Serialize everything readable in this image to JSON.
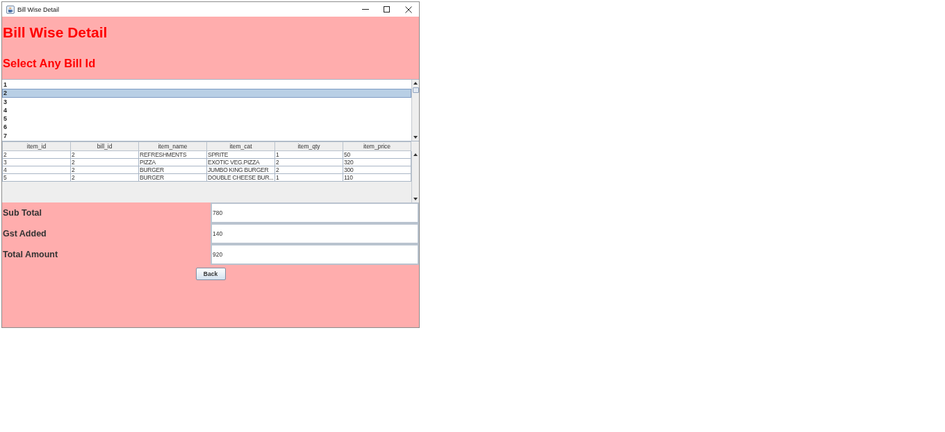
{
  "window": {
    "title": "Bill Wise Detail"
  },
  "header": {
    "title": "Bill Wise Detail",
    "subtitle": "Select Any Bill Id"
  },
  "bill_list": [
    {
      "label": "1",
      "selected": false
    },
    {
      "label": "2",
      "selected": true
    },
    {
      "label": "3",
      "selected": false
    },
    {
      "label": "4",
      "selected": false
    },
    {
      "label": "5",
      "selected": false
    },
    {
      "label": "6",
      "selected": false
    },
    {
      "label": "7",
      "selected": false
    }
  ],
  "table": {
    "columns": [
      "item_id",
      "bill_id",
      "item_name",
      "item_cat",
      "item_qty",
      "item_price"
    ],
    "rows": [
      [
        "2",
        "2",
        "REFRESHMENTS",
        "SPRITE",
        "1",
        "50"
      ],
      [
        "3",
        "2",
        "PIZZA",
        "EXOTIC VEG.PIZZA",
        "2",
        "320"
      ],
      [
        "4",
        "2",
        "BURGER",
        "JUMBO KING BURGER",
        "2",
        "300"
      ],
      [
        "5",
        "2",
        "BURGER",
        "DOUBLE CHEESE BUR...",
        "1",
        "110"
      ]
    ]
  },
  "totals": [
    {
      "label": "Sub Total",
      "value": "780"
    },
    {
      "label": "Gst Added",
      "value": "140"
    },
    {
      "label": "Total Amount",
      "value": "920"
    }
  ],
  "back_button": {
    "label": "Back"
  }
}
